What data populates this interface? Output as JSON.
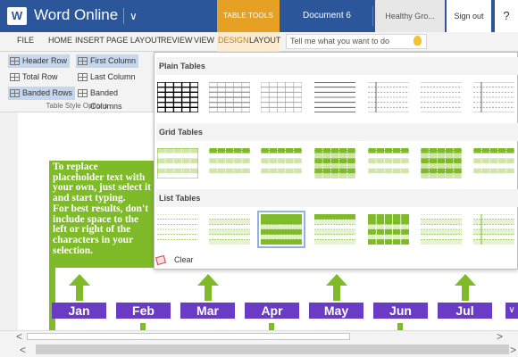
{
  "app": {
    "icon_letter": "W",
    "name": "Word Online",
    "chevron": "∨",
    "context_tab": "TABLE TOOLS",
    "document": "Document 6",
    "user": "Healthy Gro...",
    "signout": "Sign out",
    "help": "?"
  },
  "ribbon": {
    "tabs": [
      "FILE",
      "HOME",
      "INSERT",
      "PAGE LAYOUT",
      "REVIEW",
      "VIEW",
      "DESIGN",
      "LAYOUT"
    ],
    "tell_me_placeholder": "Tell me what you want to do",
    "options": [
      {
        "label": "Header Row",
        "checked": true
      },
      {
        "label": "First Column",
        "checked": true
      },
      {
        "label": "Total Row",
        "checked": false
      },
      {
        "label": "Last Column",
        "checked": false
      },
      {
        "label": "Banded Rows",
        "checked": true
      },
      {
        "label": "Banded Columns",
        "checked": false
      }
    ],
    "group_label": "Table Style Options"
  },
  "gallery": {
    "sections": [
      "Plain Tables",
      "Grid Tables",
      "List Tables"
    ],
    "clear_label": "Clear",
    "selected": "list-table-3"
  },
  "document": {
    "green_text_lines": [
      "To replace",
      "placeholder text with",
      "your own, just select it",
      "and start typing.",
      "For best results, don't",
      "include space to the",
      "left or right of the",
      "characters in your",
      "selection."
    ],
    "months": [
      "Jan",
      "Feb",
      "Mar",
      "Apr",
      "May",
      "Jun",
      "Jul"
    ],
    "colors": {
      "green": "#7fba29",
      "purple": "#6a3bc4",
      "brand_blue": "#2b579a",
      "context_orange": "#e6a023"
    }
  },
  "scroll": {
    "left_arrow": "<",
    "right_arrow": ">"
  }
}
